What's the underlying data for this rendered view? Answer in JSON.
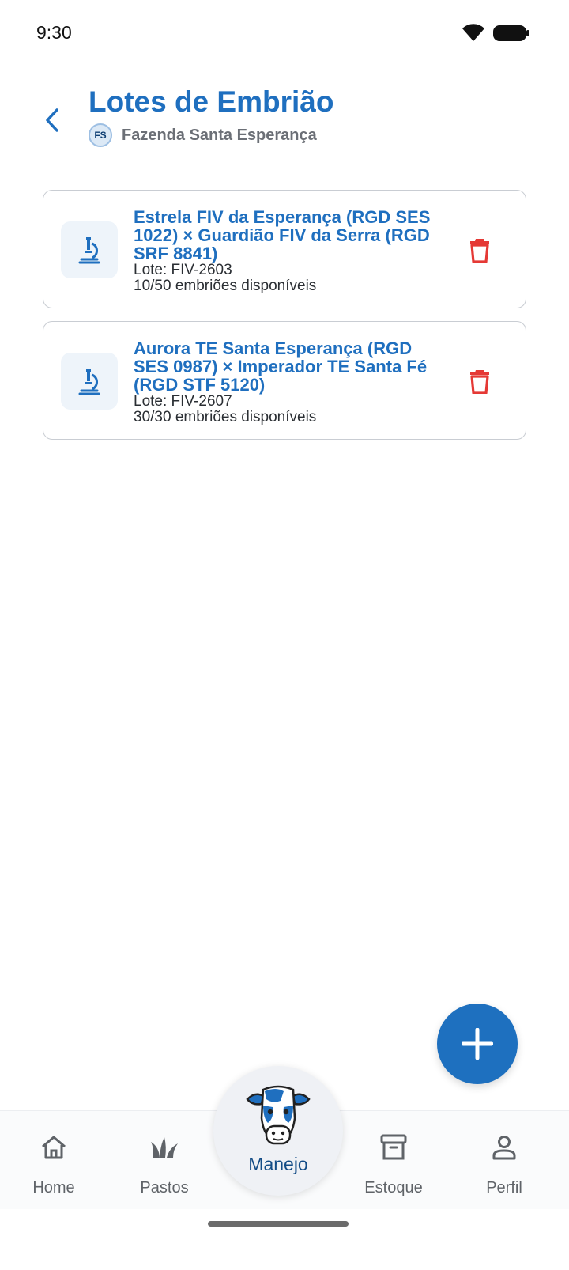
{
  "status_bar": {
    "time": "9:30"
  },
  "header": {
    "title": "Lotes de Embrião",
    "farm_initials": "FS",
    "farm_name": "Fazenda Santa Esperança"
  },
  "lots": [
    {
      "title": "Estrela FIV da Esperança (RGD SES 1022) × Guardião FIV da Serra (RGD SRF 8841)",
      "lot": "Lote: FIV-2603",
      "available": "10/50 embriões disponíveis",
      "icon": "microscope-icon"
    },
    {
      "title": "Aurora TE Santa Esperança (RGD SES 0987) × Imperador TE Santa Fé (RGD STF 5120)",
      "lot": "Lote: FIV-2607",
      "available": "30/30 embriões disponíveis",
      "icon": "microscope-icon"
    }
  ],
  "bottom_nav": {
    "home": "Home",
    "pastos": "Pastos",
    "manejo": "Manejo",
    "estoque": "Estoque",
    "perfil": "Perfil"
  },
  "colors": {
    "primary": "#1f6fbf",
    "danger": "#e53935",
    "card_border": "#c9cdd3"
  }
}
